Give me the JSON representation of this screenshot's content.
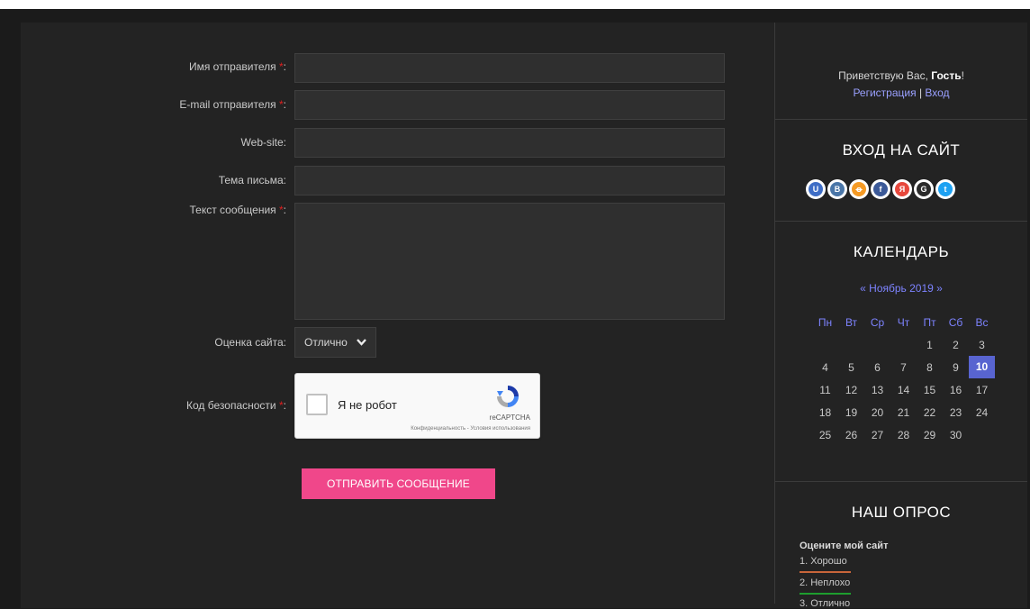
{
  "form": {
    "name_label": "Имя отправителя",
    "email_label": "E-mail отправителя",
    "website_label": "Web-site:",
    "subject_label": "Тема письма:",
    "message_label": "Текст сообщения",
    "rating_label": "Оценка сайта:",
    "rating_value": "Отлично",
    "security_label": "Код безопасности",
    "required_mark": "*",
    "colon": ":",
    "submit_label": "ОТПРАВИТЬ СООБЩЕНИЕ"
  },
  "captcha": {
    "checkbox_label": "Я не робот",
    "brand": "reCAPTCHA",
    "terms": "Конфиденциальность - Условия использования"
  },
  "sidebar": {
    "welcome_prefix": "Приветствую Вас,",
    "welcome_user": "Гость",
    "welcome_suffix": "!",
    "register_link": "Регистрация",
    "link_separator": "|",
    "login_link": "Вход",
    "login_title": "ВХОД НА САЙТ",
    "socials": [
      {
        "name": "ucoz-icon",
        "glyph": "U",
        "color": "#3f6ec6"
      },
      {
        "name": "vk-icon",
        "glyph": "B",
        "color": "#4a76a8"
      },
      {
        "name": "odnoklassniki-icon",
        "glyph": "ꝋ",
        "color": "#f59a24"
      },
      {
        "name": "facebook-icon",
        "glyph": "f",
        "color": "#3b5998"
      },
      {
        "name": "yandex-icon",
        "glyph": "Я",
        "color": "#e7483c"
      },
      {
        "name": "google-icon",
        "glyph": "G",
        "color": "#2b2b2b"
      },
      {
        "name": "twitter-icon",
        "glyph": "t",
        "color": "#1da1f2"
      }
    ],
    "calendar_title": "КАЛЕНДАРЬ",
    "calendar_prev": "«",
    "calendar_month": "Ноябрь 2019",
    "calendar_next": "»",
    "weekdays": [
      "Пн",
      "Вт",
      "Ср",
      "Чт",
      "Пт",
      "Сб",
      "Вс"
    ],
    "weeks": [
      [
        "",
        "",
        "",
        "",
        "1",
        "2",
        "3"
      ],
      [
        "4",
        "5",
        "6",
        "7",
        "8",
        "9",
        "10"
      ],
      [
        "11",
        "12",
        "13",
        "14",
        "15",
        "16",
        "17"
      ],
      [
        "18",
        "19",
        "20",
        "21",
        "22",
        "23",
        "24"
      ],
      [
        "25",
        "26",
        "27",
        "28",
        "29",
        "30",
        ""
      ]
    ],
    "today": "10",
    "poll_title": "НАШ ОПРОС",
    "poll_question": "Оцените мой сайт",
    "poll_options": [
      {
        "label": "1. Хорошо",
        "color": "#c8653a"
      },
      {
        "label": "2. Неплохо",
        "color": "#1e9e2e"
      },
      {
        "label": "3. Отлично",
        "color": "#1e9e2e"
      }
    ]
  },
  "colors": {
    "accent": "#f0478a",
    "link": "#7d83ff",
    "today_bg": "#5864d0"
  }
}
